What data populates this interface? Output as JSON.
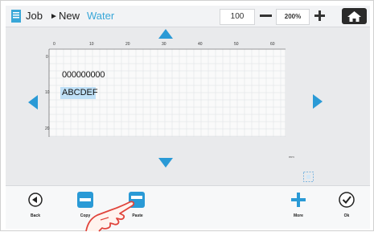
{
  "header": {
    "breadcrumb": {
      "root": "Job",
      "separator": "►",
      "current": "New",
      "job_name": "Water"
    },
    "zoom": {
      "step_value": "100",
      "zoom_level": "200%"
    }
  },
  "ruler": {
    "top_ticks": [
      "0",
      "10",
      "20",
      "30",
      "40",
      "50",
      "60"
    ],
    "left_ticks": [
      "0",
      "10",
      "20"
    ]
  },
  "canvas": {
    "text_objects": [
      {
        "text": "000000000",
        "selected": false
      },
      {
        "text": "ABCDEF",
        "selected": true
      }
    ],
    "unit": "mm"
  },
  "toolbar": {
    "back_label": "Back",
    "copy_label": "Copy",
    "paste_label": "Paste",
    "more_label": "More",
    "ok_label": "Ok"
  },
  "colors": {
    "accent": "#2a9ad6",
    "selection": "#bfe0f7",
    "text_accent": "#39a7d8",
    "watermark": "#d9534f"
  },
  "icons": [
    "file-icon",
    "home-icon",
    "back-icon",
    "copy-icon",
    "paste-icon",
    "plus-icon",
    "check-icon",
    "hand-pointer-icon"
  ]
}
